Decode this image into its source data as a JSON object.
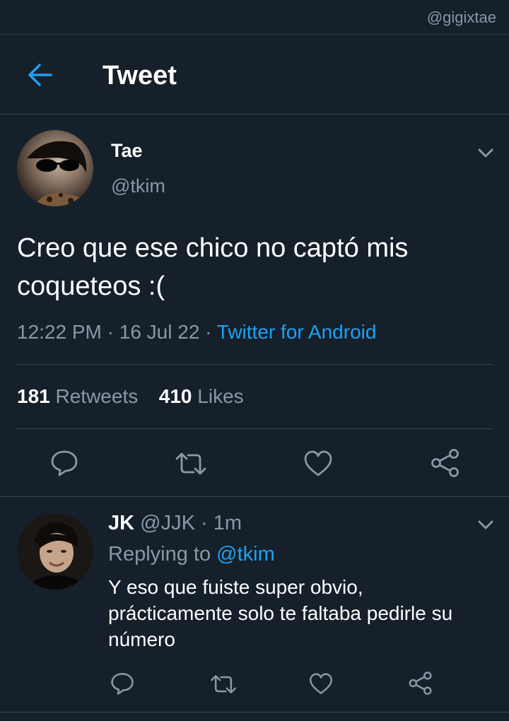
{
  "watermark": "@gigixtae",
  "header": {
    "title": "Tweet"
  },
  "tweet": {
    "name": "Tae",
    "handle": "@tkim",
    "text": "Creo que ese chico no captó mis coqueteos :(",
    "time": "12:22 PM",
    "date": "16 Jul 22",
    "source": "Twitter for Android",
    "retweets": "181",
    "retweets_label": "Retweets",
    "likes": "410",
    "likes_label": "Likes"
  },
  "reply": {
    "name": "JK",
    "handle": "@JJK",
    "time": "1m",
    "replying_label": "Replying to",
    "replying_to": "@tkim",
    "text": "Y eso que fuiste super obvio, prácticamente solo te faltaba pedirle su número"
  },
  "icons": {
    "back": "arrow-left-icon",
    "more": "chevron-down-icon",
    "reply": "comment-icon",
    "retweet": "retweet-icon",
    "like": "heart-icon",
    "share": "share-icon"
  },
  "colors": {
    "background": "#15202b",
    "accent": "#1da1f2",
    "muted": "#8899a6",
    "divider": "#38444d"
  },
  "separators": {
    "dot": " · "
  }
}
